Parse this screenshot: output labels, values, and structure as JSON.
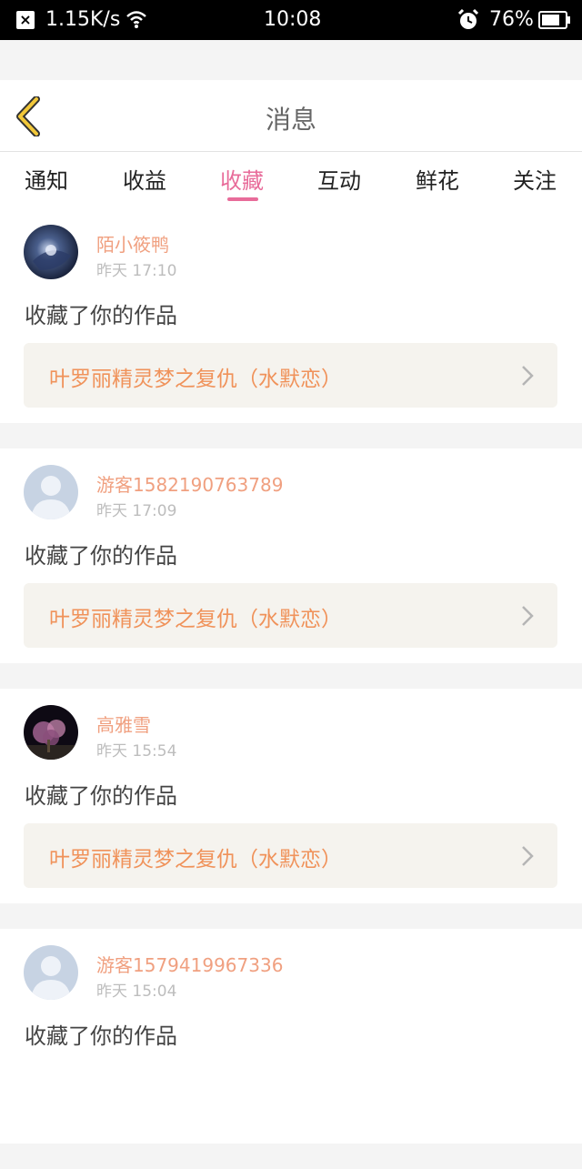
{
  "status_bar": {
    "speed": "1.15K/s",
    "time": "10:08",
    "battery": "76%"
  },
  "header": {
    "title": "消息"
  },
  "tabs": [
    {
      "label": "通知"
    },
    {
      "label": "收益"
    },
    {
      "label": "收藏",
      "active": true
    },
    {
      "label": "互动"
    },
    {
      "label": "鲜花"
    },
    {
      "label": "关注"
    }
  ],
  "messages": [
    {
      "username": "陌小筱鸭",
      "time": "昨天 17:10",
      "action": "收藏了你的作品",
      "work": "叶罗丽精灵梦之复仇（水默恋）",
      "avatar": "dark-blue-photo"
    },
    {
      "username": "游客1582190763789",
      "time": "昨天 17:09",
      "action": "收藏了你的作品",
      "work": "叶罗丽精灵梦之复仇（水默恋）",
      "avatar": "default-person"
    },
    {
      "username": "高雅雪",
      "time": "昨天 15:54",
      "action": "收藏了你的作品",
      "work": "叶罗丽精灵梦之复仇（水默恋）",
      "avatar": "night-blossom-photo"
    },
    {
      "username": "游客1579419967336",
      "time": "昨天 15:04",
      "action": "收藏了你的作品",
      "work": "",
      "avatar": "default-person"
    }
  ],
  "colors": {
    "accent": "#e86c9a",
    "username": "#f0a080",
    "work_title": "#f0925a",
    "back_icon": "#f2c83a"
  }
}
